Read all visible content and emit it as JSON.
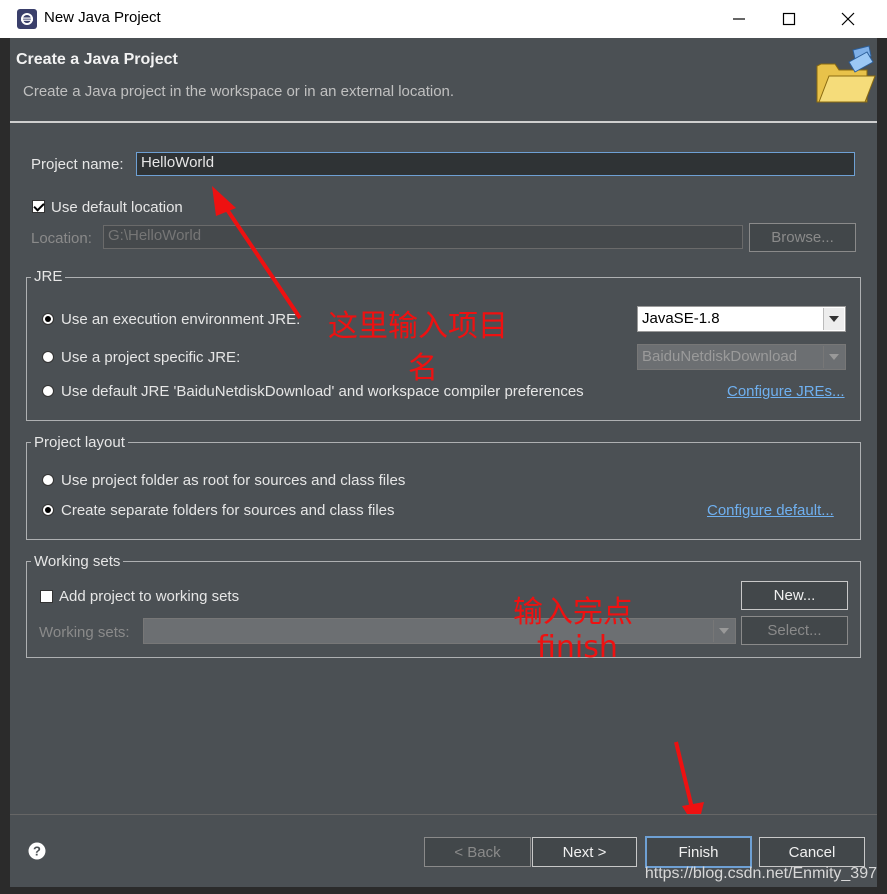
{
  "window": {
    "title": "New Java Project",
    "minimize_label": "—",
    "maximize_label": "☐",
    "close_label": "✕"
  },
  "header": {
    "title": "Create a Java Project",
    "description": "Create a Java project in the workspace or in an external location.",
    "banner_icon": "folder-wizard-icon"
  },
  "project": {
    "name_label": "Project name:",
    "name_value": "HelloWorld",
    "use_default_location_label": "Use default location",
    "use_default_location_checked": true,
    "location_label": "Location:",
    "location_value": "G:\\HelloWorld",
    "browse_label": "Browse..."
  },
  "jre": {
    "group_title": "JRE",
    "option_execution_env_label": "Use an execution environment JRE:",
    "execution_env_value": "JavaSE-1.8",
    "option_project_specific_label": "Use a project specific JRE:",
    "project_specific_value": "BaiduNetdiskDownload",
    "option_default_label": "Use default JRE 'BaiduNetdiskDownload' and workspace compiler preferences",
    "configure_link": "Configure JREs..."
  },
  "layout": {
    "group_title": "Project layout",
    "option_root_label": "Use project folder as root for sources and class files",
    "option_separate_label": "Create separate folders for sources and class files",
    "configure_link": "Configure default..."
  },
  "working_sets": {
    "group_title": "Working sets",
    "add_label": "Add project to working sets",
    "new_label": "New...",
    "sets_label": "Working sets:",
    "select_label": "Select..."
  },
  "annotations": {
    "name_hint_line1": "这里输入项目",
    "name_hint_line2": "名",
    "finish_hint_line1": "输入完点",
    "finish_hint_line2": "finish",
    "color": "#ee1111"
  },
  "footer": {
    "help_icon": "help-icon",
    "back_label": "< Back",
    "next_label": "Next >",
    "finish_label": "Finish",
    "cancel_label": "Cancel"
  },
  "watermark": "https://blog.csdn.net/Enmity_397"
}
